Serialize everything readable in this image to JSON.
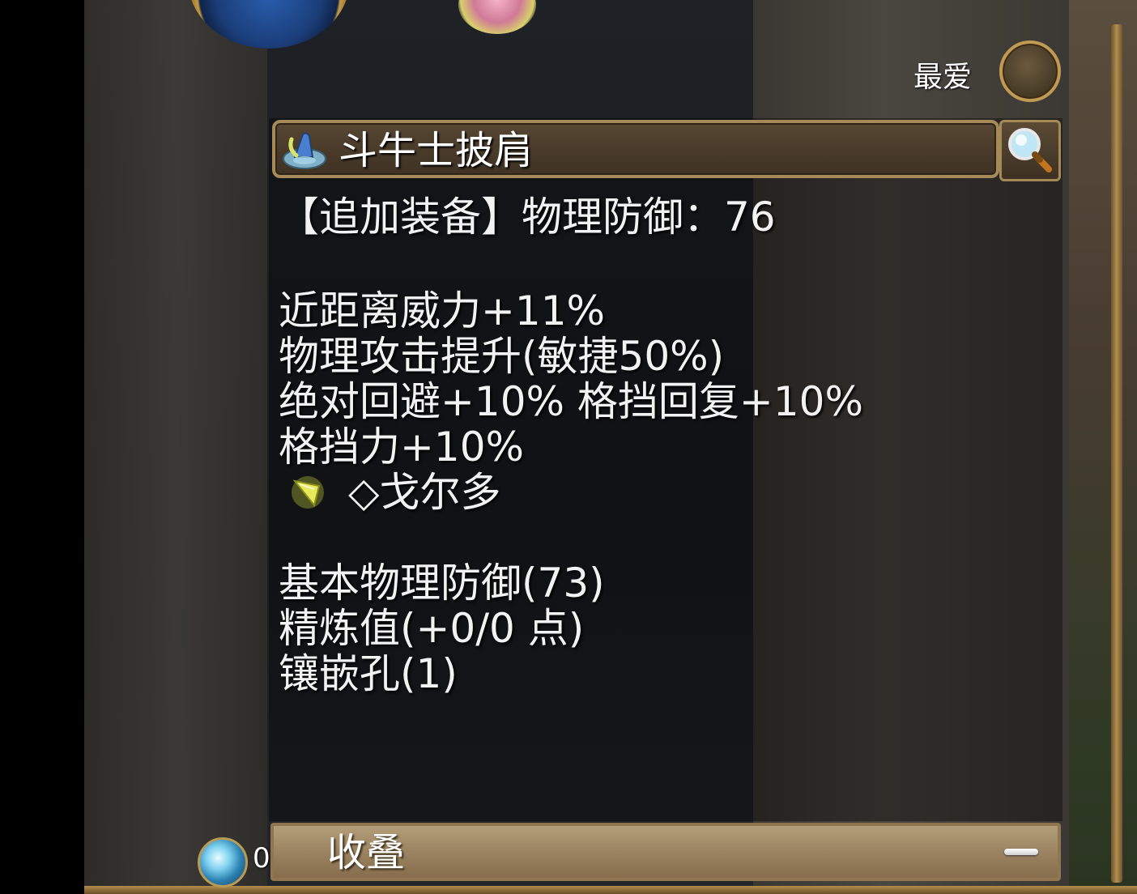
{
  "favorite": {
    "label": "最爱"
  },
  "item": {
    "name": "斗牛士披肩",
    "icon": "cape-icon"
  },
  "search": {
    "icon": "magnifier-icon"
  },
  "description": {
    "header": "【追加装备】物理防御：76",
    "effects": [
      "近距离威力+11%",
      "物理攻击提升(敏捷50%)",
      "绝对回避+10% 格挡回复+10%",
      "格挡力+10%"
    ],
    "card": {
      "icon": "card-icon",
      "text": "◇戈尔多"
    },
    "stats": [
      "基本物理防御(73)",
      "精炼值(+0/0 点)",
      "镶嵌孔(1)"
    ]
  },
  "collapse": {
    "label": "收叠",
    "icon": "minus-icon"
  },
  "currency": {
    "icon": "orb-icon",
    "count": "0"
  }
}
